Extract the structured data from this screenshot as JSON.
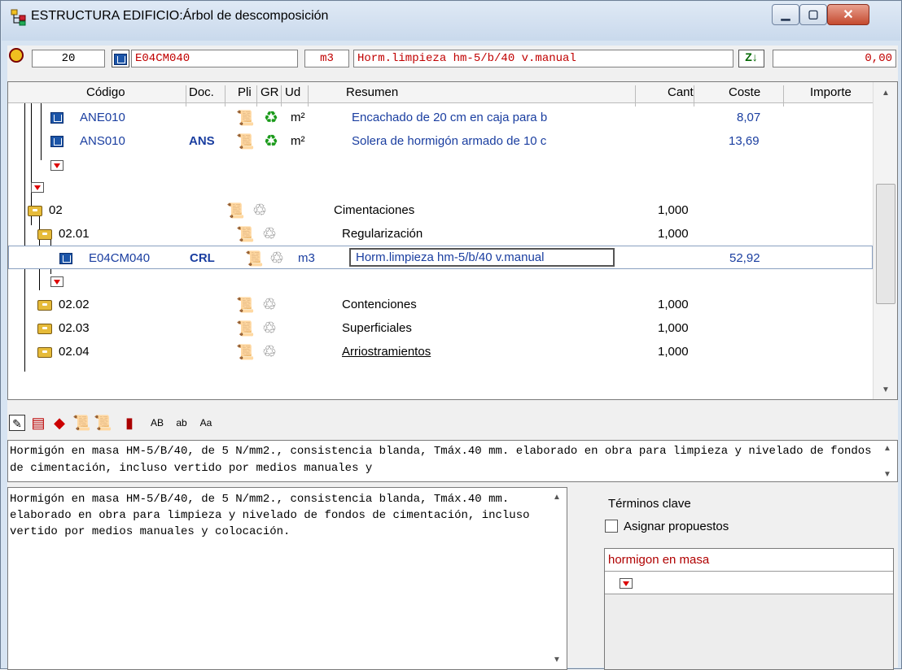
{
  "window": {
    "title": "ESTRUCTURA EDIFICIO:Árbol de descomposición",
    "min_label": "▁",
    "max_label": "▢",
    "close_label": "✕"
  },
  "topbar": {
    "quantity": "20",
    "code": "E04CM040",
    "unit": "m3",
    "summary": "Horm.limpieza hm-5/b/40 v.manual",
    "amount": "0,00"
  },
  "columns": {
    "codigo": "Código",
    "doc": "Doc.",
    "pli": "Pli",
    "gr": "GR",
    "ud": "Ud",
    "resumen": "Resumen",
    "cant": "Cant",
    "coste": "Coste",
    "importe": "Importe"
  },
  "rows": [
    {
      "code": "ANE010",
      "doc": "",
      "ud": "m²",
      "summary": "Encachado de 20 cm en caja para b",
      "cant": "",
      "coste": "8,07"
    },
    {
      "code": "ANS010",
      "doc": "ANS",
      "ud": "m²",
      "summary": "Solera de hormigón armado de 10 c",
      "cant": "",
      "coste": "13,69"
    },
    {
      "code": "02",
      "doc": "",
      "ud": "",
      "summary": "Cimentaciones",
      "cant": "1,000",
      "coste": ""
    },
    {
      "code": "02.01",
      "doc": "",
      "ud": "",
      "summary": "Regularización",
      "cant": "1,000",
      "coste": ""
    },
    {
      "code": "E04CM040",
      "doc": "CRL",
      "ud": "m3",
      "summary": "Horm.limpieza hm-5/b/40 v.manual",
      "cant": "",
      "coste": "52,92"
    },
    {
      "code": "02.02",
      "doc": "",
      "ud": "",
      "summary": "Contenciones",
      "cant": "1,000",
      "coste": ""
    },
    {
      "code": "02.03",
      "doc": "",
      "ud": "",
      "summary": "Superficiales",
      "cant": "1,000",
      "coste": ""
    },
    {
      "code": "02.04",
      "doc": "",
      "ud": "",
      "summary": "Arriostramientos",
      "cant": "1,000",
      "coste": ""
    }
  ],
  "description": "Hormigón en masa HM-5/B/40, de 5 N/mm2., consistencia blanda, Tmáx.40 mm. elaborado en obra para limpieza y nivelado de fondos de cimentación, incluso vertido por medios manuales y",
  "long_text": "Hormigón en masa HM-5/B/40, de 5 N/mm2., consistencia blanda, Tmáx.40 mm. elaborado en obra para limpieza y nivelado de fondos de cimentación, incluso vertido por medios manuales y colocación.",
  "keywords": {
    "title": "Términos clave",
    "assign_label": "Asignar propuestos",
    "items": [
      "hormigon en masa"
    ]
  },
  "toolbar": {
    "case_upper": "AB",
    "case_lower": "ab",
    "case_mixed": "Aa"
  }
}
